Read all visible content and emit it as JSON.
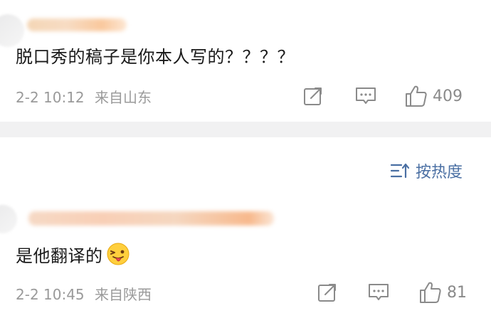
{
  "comments": [
    {
      "text": "脱口秀的稿子是你本人写的？？？？",
      "date": "2-2 10:12",
      "location": "来自山东",
      "likes": "409"
    },
    {
      "text": "是他翻译的",
      "emoji": "tongue-wink-emoji",
      "date": "2-2 10:45",
      "location": "来自陕西",
      "likes": "81"
    }
  ],
  "sort": {
    "label": "按热度",
    "icon": "sort-icon"
  },
  "icons": [
    "share-icon",
    "comment-icon",
    "like-icon",
    "sort-icon"
  ]
}
